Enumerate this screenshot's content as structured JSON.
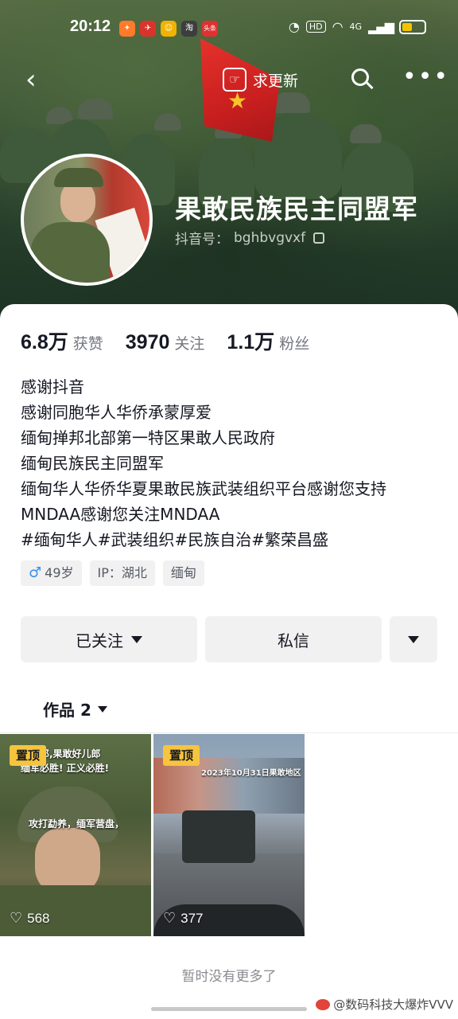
{
  "status_bar": {
    "time": "20:12",
    "app_icons": [
      {
        "name": "notif-app-1",
        "color": "#ff7a2b",
        "glyph": "✦"
      },
      {
        "name": "notif-app-2",
        "color": "#d9342b",
        "glyph": "✈"
      },
      {
        "name": "notif-app-3",
        "color": "#f2b200",
        "glyph": "☺"
      },
      {
        "name": "notif-app-4",
        "color": "#3d3d3d",
        "glyph": "淘"
      },
      {
        "name": "notif-app-5",
        "color": "#e03131",
        "glyph": "头条"
      }
    ],
    "network_label": "HD",
    "signal_label": "4G"
  },
  "nav": {
    "back_icon": "‹",
    "update_label": "求更新",
    "more_icon": "•••"
  },
  "profile": {
    "name": "果敢民族民主同盟军",
    "id_label": "抖音号：",
    "id_value": "bghbvgvxf"
  },
  "stats": [
    {
      "value": "6.8万",
      "label": "获赞"
    },
    {
      "value": "3970",
      "label": "关注"
    },
    {
      "value": "1.1万",
      "label": "粉丝"
    }
  ],
  "bio": [
    "感谢抖音",
    "感谢同胞华人华侨承蒙厚爱",
    "缅甸掸邦北部第一特区果敢人民政府",
    "缅甸民族民主同盟军",
    "缅甸华人华侨华夏果敢民族武装组织平台感谢您支持",
    "MNDAA感谢您关注MNDAA",
    "#缅甸华人#武装组织#民族自治#繁荣昌盛"
  ],
  "tags": {
    "age": "49岁",
    "ip": "IP：湖北",
    "location": "缅甸"
  },
  "actions": {
    "follow_label": "已关注",
    "message_label": "私信"
  },
  "works": {
    "tab_label": "作品 2",
    "items": [
      {
        "pinned_label": "置顶",
        "likes": "568",
        "caption_top": "好儿郎,果敢好儿郎",
        "caption_mid": "缅军必胜! 正义必胜!",
        "caption_bottom": "攻打勐养，缅军营盘，"
      },
      {
        "pinned_label": "置顶",
        "likes": "377",
        "caption_top": "2023年10月31日果敢地区"
      }
    ],
    "no_more_label": "暂时没有更多了"
  },
  "watermark": "@数码科技大爆炸VVV",
  "colors": {
    "accent_pin": "#f6c43d",
    "male": "#3a8ee8",
    "text_primary": "#161823",
    "text_secondary": "#75777f"
  }
}
